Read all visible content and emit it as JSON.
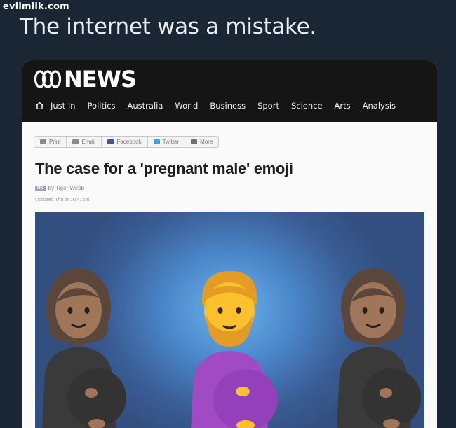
{
  "watermark": "evilmilk.com",
  "tweet": {
    "text": "The internet was a mistake."
  },
  "abc": {
    "logo_text": "NEWS",
    "nav": [
      "Just In",
      "Politics",
      "Australia",
      "World",
      "Business",
      "Sport",
      "Science",
      "Arts",
      "Analysis"
    ]
  },
  "share": [
    {
      "label": "Print",
      "icon": "print-icon",
      "color": "#8a8a8a"
    },
    {
      "label": "Email",
      "icon": "email-icon",
      "color": "#8a8a8a"
    },
    {
      "label": "Facebook",
      "icon": "facebook-icon",
      "color": "#3b5998"
    },
    {
      "label": "Twitter",
      "icon": "twitter-icon",
      "color": "#3aa1e6"
    },
    {
      "label": "More",
      "icon": "more-icon",
      "color": "#707070"
    }
  ],
  "article": {
    "headline": "The case for a 'pregnant male' emoji",
    "program_badge": "RN",
    "byline": "by Tiger Webb",
    "updated": "Updated Thu at 10:41pm"
  },
  "hero": {
    "figures": [
      "pregnant-woman-emoji",
      "pregnant-man-emoji",
      "pregnant-woman-emoji"
    ],
    "colors": {
      "dark_shirt": "#3a3a3a",
      "purple_shirt": "#a04ac4",
      "skin_dark": "#a0765a",
      "skin_yellow": "#fbc02d",
      "hair_dark": "#5a463a",
      "hair_orange": "#e49c25"
    }
  }
}
